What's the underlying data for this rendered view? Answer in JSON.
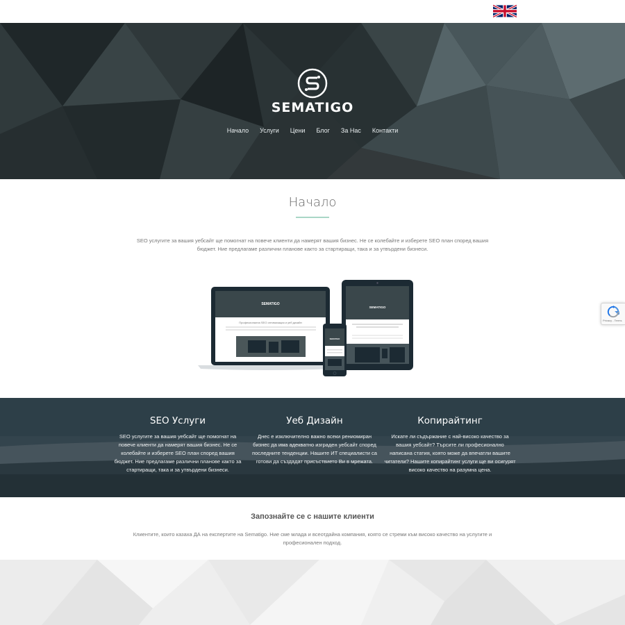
{
  "header": {
    "language_flag_icon": "uk-flag-icon"
  },
  "hero": {
    "logo_icon": "sematigo-s-logo-icon",
    "logo_text": "SEMATIGO",
    "nav": [
      {
        "label": "Начало"
      },
      {
        "label": "Услуги"
      },
      {
        "label": "Цени"
      },
      {
        "label": "Блог"
      },
      {
        "label": "За Нас"
      },
      {
        "label": "Контакти"
      }
    ]
  },
  "intro": {
    "title": "Начало",
    "text": "SEO услугите за вашия уебсайт ще помогнат на повече клиенти да намерят вашия бизнес. Не се колебайте и изберете SEO план според вашия бюджет. Ние предлагаме различни планове както за стартиращи, така и за утвърдени бизнеси."
  },
  "devices_mockup": {
    "logo_text": "SEMATIGO",
    "headline": "Професионална SEO оптимизация и уеб дизайн"
  },
  "recaptcha": {
    "icon": "recaptcha-icon",
    "text": "Privacy - Terms"
  },
  "services": [
    {
      "title": "SEO Услуги",
      "text": "SEO услугите за вашия уебсайт ще помогнат на повече клиенти да намерят вашия бизнес. Не се колебайте и изберете SEO план според вашия бюджет. Ние предлагаме различни планове както за стартиращи, така и за утвърдени бизнеси."
    },
    {
      "title": "Уеб Дизайн",
      "text": "Днес е изключително важно всеки рениомиран бизнес да има адекватно изграден уебсайт според последните тенденции. Нашите ИТ специалисти са готови да създадат присъствието Ви в мрежата."
    },
    {
      "title": "Копирайтинг",
      "text": "Искате ли съдържание с най-високо качество за вашия уебсайт? Търсите ли професионално написана статия, която може да впечатли вашите читатели? Нашите копирайтинг услуги ще ви осигурят високо качество на разумна цена."
    }
  ],
  "clients": {
    "title": "Запознайте се с нашите клиенти",
    "text": "Клиентите, които казаха ДА на експертите на Sematigo. Ние сме млада и всеотдайна компания, която се стреми към високо качество на услугите и професионален подход."
  },
  "colors": {
    "accent_underline": "#a9d6c6",
    "hero_dark": "#2a3234",
    "band_dark": "#33444c"
  }
}
